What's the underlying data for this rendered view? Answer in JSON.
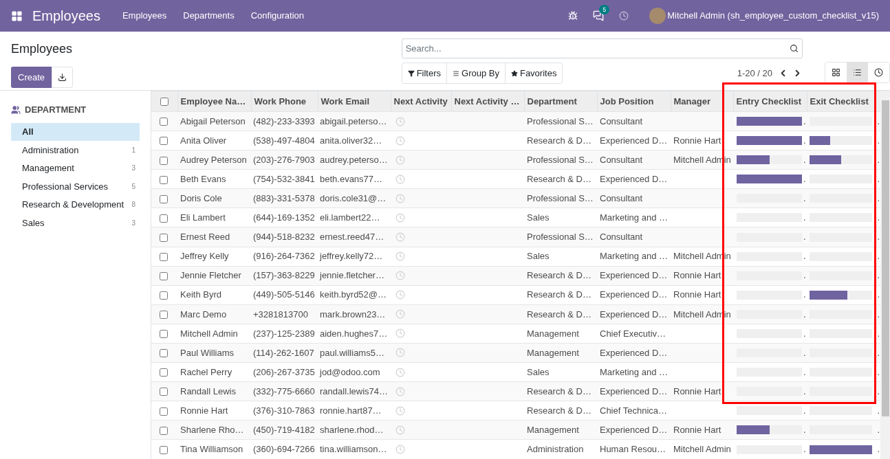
{
  "navbar": {
    "app_title": "Employees",
    "menu": [
      "Employees",
      "Departments",
      "Configuration"
    ],
    "chat_badge": "5",
    "user": "Mitchell Admin (sh_employee_custom_checklist_v15)"
  },
  "breadcrumb": "Employees",
  "create_button": "Create",
  "search": {
    "placeholder": "Search..."
  },
  "filters": [
    "Filters",
    "Group By",
    "Favorites"
  ],
  "pager": "1-20 / 20",
  "views": [
    {
      "kind": "kanban",
      "selected": false
    },
    {
      "kind": "list",
      "selected": true
    },
    {
      "kind": "activity",
      "selected": false
    }
  ],
  "sidebar": {
    "heading": "DEPARTMENT",
    "items": [
      {
        "label": "All",
        "selected": true
      },
      {
        "label": "Administration",
        "count": "1",
        "selected": false
      },
      {
        "label": "Management",
        "count": "3",
        "selected": false
      },
      {
        "label": "Professional Services",
        "count": "5",
        "selected": false
      },
      {
        "label": "Research & Development",
        "count": "8",
        "selected": false
      },
      {
        "label": "Sales",
        "count": "3",
        "selected": false
      }
    ]
  },
  "highlight_frame": true,
  "table": {
    "select_all_checked": false,
    "columns": [
      "Employee Na…",
      "Work Phone",
      "Work Email",
      "Next Activity",
      "Next Activity …",
      "Department",
      "Job Position",
      "Manager",
      "Entry Checklist",
      "Exit Checklist"
    ],
    "rows": [
      {
        "checked": false,
        "name": "Abigail Peterson",
        "phone": "(482)-233-3393",
        "email": "abigail.peterso…",
        "department": "Professional S…",
        "job": "Consultant",
        "entry": {
          "level": 1,
          "mark": "."
        },
        "exit": {
          "level": 0,
          "mark": "."
        }
      },
      {
        "checked": false,
        "name": "Anita Oliver",
        "phone": "(538)-497-4804",
        "email": "anita.oliver32…",
        "department": "Research & D…",
        "job": "Experienced D…",
        "manager": "Ronnie Hart",
        "entry": {
          "level": 1,
          "mark": "."
        },
        "exit": {
          "level": 0.33,
          "mark": "."
        }
      },
      {
        "checked": false,
        "name": "Audrey Peterson",
        "phone": "(203)-276-7903",
        "email": "audrey.peterso…",
        "department": "Professional S…",
        "job": "Consultant",
        "manager": "Mitchell Admin",
        "entry": {
          "level": 0.5,
          "mark": "."
        },
        "exit": {
          "level": 0.5,
          "mark": "."
        }
      },
      {
        "checked": false,
        "name": "Beth Evans",
        "phone": "(754)-532-3841",
        "email": "beth.evans77…",
        "department": "Research & D…",
        "job": "Experienced D…",
        "entry": {
          "level": 1,
          "mark": "."
        },
        "exit": {
          "level": 0,
          "mark": "."
        }
      },
      {
        "checked": false,
        "name": "Doris Cole",
        "phone": "(883)-331-5378",
        "email": "doris.cole31@…",
        "department": "Professional S…",
        "job": "Consultant",
        "entry": {
          "level": 0,
          "mark": "."
        },
        "exit": {
          "level": 0,
          "mark": "."
        }
      },
      {
        "checked": false,
        "name": "Eli Lambert",
        "phone": "(644)-169-1352",
        "email": "eli.lambert22…",
        "department": "Sales",
        "job": "Marketing and …",
        "entry": {
          "level": 0,
          "mark": "."
        },
        "exit": {
          "level": 0,
          "mark": "."
        }
      },
      {
        "checked": false,
        "name": "Ernest Reed",
        "phone": "(944)-518-8232",
        "email": "ernest.reed47…",
        "department": "Professional S…",
        "job": "Consultant",
        "entry": {
          "level": 0,
          "mark": "."
        },
        "exit": {
          "level": 0,
          "mark": "."
        }
      },
      {
        "checked": false,
        "name": "Jeffrey Kelly",
        "phone": "(916)-264-7362",
        "email": "jeffrey.kelly72…",
        "department": "Sales",
        "job": "Marketing and …",
        "manager": "Mitchell Admin",
        "entry": {
          "level": 0,
          "mark": "."
        },
        "exit": {
          "level": 0,
          "mark": "."
        }
      },
      {
        "checked": false,
        "name": "Jennie Fletcher",
        "phone": "(157)-363-8229",
        "email": "jennie.fletcher…",
        "department": "Research & D…",
        "job": "Experienced D…",
        "manager": "Ronnie Hart",
        "entry": {
          "level": 0,
          "mark": "."
        },
        "exit": {
          "level": 0,
          "mark": "."
        }
      },
      {
        "checked": false,
        "name": "Keith Byrd",
        "phone": "(449)-505-5146",
        "email": "keith.byrd52@…",
        "department": "Research & D…",
        "job": "Experienced D…",
        "manager": "Ronnie Hart",
        "entry": {
          "level": 0,
          "mark": "."
        },
        "exit": {
          "level": 0.6,
          "mark": "."
        }
      },
      {
        "checked": false,
        "name": "Marc Demo",
        "phone": "+3281813700",
        "email": "mark.brown23…",
        "department": "Research & D…",
        "job": "Experienced D…",
        "manager": "Mitchell Admin",
        "entry": {
          "level": 0,
          "mark": "."
        },
        "exit": {
          "level": 0,
          "mark": "."
        }
      },
      {
        "checked": false,
        "name": "Mitchell Admin",
        "phone": "(237)-125-2389",
        "email": "aiden.hughes7…",
        "department": "Management",
        "job": "Chief Executiv…",
        "entry": {
          "level": 0,
          "mark": "."
        },
        "exit": {
          "level": 0,
          "mark": "."
        }
      },
      {
        "checked": false,
        "name": "Paul Williams",
        "phone": "(114)-262-1607",
        "email": "paul.williams5…",
        "department": "Management",
        "job": "Experienced D…",
        "entry": {
          "level": 0,
          "mark": "."
        },
        "exit": {
          "level": 0,
          "mark": "."
        }
      },
      {
        "checked": false,
        "name": "Rachel Perry",
        "phone": "(206)-267-3735",
        "email": "jod@odoo.com",
        "department": "Sales",
        "job": "Marketing and …",
        "entry": {
          "level": 0,
          "mark": "."
        },
        "exit": {
          "level": 0,
          "mark": "."
        }
      },
      {
        "checked": false,
        "name": "Randall Lewis",
        "phone": "(332)-775-6660",
        "email": "randall.lewis74…",
        "department": "Research & D…",
        "job": "Experienced D…",
        "manager": "Ronnie Hart",
        "entry": {
          "level": 0,
          "mark": "."
        },
        "exit": {
          "level": 0,
          "mark": "."
        }
      },
      {
        "checked": false,
        "name": "Ronnie Hart",
        "phone": "(376)-310-7863",
        "email": "ronnie.hart87…",
        "department": "Research & D…",
        "job": "Chief Technica…",
        "entry": {
          "level": 0,
          "mark": "."
        },
        "exit": {
          "level": 0,
          "mark": "."
        }
      },
      {
        "checked": false,
        "name": "Sharlene Rho…",
        "phone": "(450)-719-4182",
        "email": "sharlene.rhod…",
        "department": "Management",
        "job": "Experienced D…",
        "manager": "Ronnie Hart",
        "entry": {
          "level": 0.5,
          "mark": "."
        },
        "exit": {
          "level": 0,
          "mark": "."
        }
      },
      {
        "checked": false,
        "name": "Tina Williamson",
        "phone": "(360)-694-7266",
        "email": "tina.williamson…",
        "department": "Administration",
        "job": "Human Resou…",
        "manager": "Mitchell Admin",
        "entry": {
          "level": 0,
          "mark": "."
        },
        "exit": {
          "level": 1,
          "mark": "."
        }
      }
    ]
  }
}
